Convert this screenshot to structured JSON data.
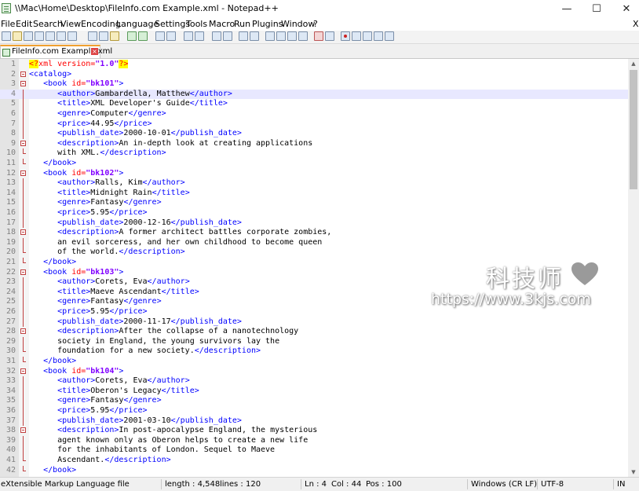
{
  "window": {
    "title": "\\\\Mac\\Home\\Desktop\\FileInfo.com Example.xml - Notepad++",
    "minimize_glyph": "—",
    "maximize_glyph": "☐",
    "close_glyph": "✕"
  },
  "menu": {
    "items": [
      "File",
      "Edit",
      "Search",
      "View",
      "Encoding",
      "Language",
      "Settings",
      "Tools",
      "Macro",
      "Run",
      "Plugins",
      "Window",
      "?"
    ],
    "doc_close": "X"
  },
  "tab": {
    "label": "FileInfo.com Example.xml",
    "close_glyph": "×",
    "icon": "xml-file-icon"
  },
  "editor": {
    "current_line": 4,
    "lines": [
      {
        "n": "1",
        "fold": "none",
        "c": [
          [
            "d",
            "<?"
          ],
          [
            "a",
            "xml version="
          ],
          [
            "v",
            "\"1.0\""
          ],
          [
            "d",
            "?>"
          ]
        ]
      },
      {
        "n": "2",
        "fold": "start",
        "c": [
          [
            "t",
            "<catalog>"
          ]
        ]
      },
      {
        "n": "3",
        "fold": "start",
        "c": [
          [
            "x",
            "   "
          ],
          [
            "t",
            "<book "
          ],
          [
            "a",
            "id="
          ],
          [
            "v",
            "\"bk101\""
          ],
          [
            "t",
            ">"
          ]
        ]
      },
      {
        "n": "4",
        "fold": "line",
        "c": [
          [
            "x",
            "      "
          ],
          [
            "t",
            "<author>"
          ],
          [
            "x",
            "Gambardella, Matthew"
          ],
          [
            "t",
            "</author>"
          ]
        ]
      },
      {
        "n": "5",
        "fold": "line",
        "c": [
          [
            "x",
            "      "
          ],
          [
            "t",
            "<title>"
          ],
          [
            "x",
            "XML Developer's Guide"
          ],
          [
            "t",
            "</title>"
          ]
        ]
      },
      {
        "n": "6",
        "fold": "line",
        "c": [
          [
            "x",
            "      "
          ],
          [
            "t",
            "<genre>"
          ],
          [
            "x",
            "Computer"
          ],
          [
            "t",
            "</genre>"
          ]
        ]
      },
      {
        "n": "7",
        "fold": "line",
        "c": [
          [
            "x",
            "      "
          ],
          [
            "t",
            "<price>"
          ],
          [
            "x",
            "44.95"
          ],
          [
            "t",
            "</price>"
          ]
        ]
      },
      {
        "n": "8",
        "fold": "line",
        "c": [
          [
            "x",
            "      "
          ],
          [
            "t",
            "<publish_date>"
          ],
          [
            "x",
            "2000-10-01"
          ],
          [
            "t",
            "</publish_date>"
          ]
        ]
      },
      {
        "n": "9",
        "fold": "start",
        "c": [
          [
            "x",
            "      "
          ],
          [
            "t",
            "<description>"
          ],
          [
            "x",
            "An in-depth look at creating applications"
          ]
        ]
      },
      {
        "n": "10",
        "fold": "end",
        "c": [
          [
            "x",
            "      with XML."
          ],
          [
            "t",
            "</description>"
          ]
        ]
      },
      {
        "n": "11",
        "fold": "end",
        "c": [
          [
            "x",
            "   "
          ],
          [
            "t",
            "</book>"
          ]
        ]
      },
      {
        "n": "12",
        "fold": "start",
        "c": [
          [
            "x",
            "   "
          ],
          [
            "t",
            "<book "
          ],
          [
            "a",
            "id="
          ],
          [
            "v",
            "\"bk102\""
          ],
          [
            "t",
            ">"
          ]
        ]
      },
      {
        "n": "13",
        "fold": "line",
        "c": [
          [
            "x",
            "      "
          ],
          [
            "t",
            "<author>"
          ],
          [
            "x",
            "Ralls, Kim"
          ],
          [
            "t",
            "</author>"
          ]
        ]
      },
      {
        "n": "14",
        "fold": "line",
        "c": [
          [
            "x",
            "      "
          ],
          [
            "t",
            "<title>"
          ],
          [
            "x",
            "Midnight Rain"
          ],
          [
            "t",
            "</title>"
          ]
        ]
      },
      {
        "n": "15",
        "fold": "line",
        "c": [
          [
            "x",
            "      "
          ],
          [
            "t",
            "<genre>"
          ],
          [
            "x",
            "Fantasy"
          ],
          [
            "t",
            "</genre>"
          ]
        ]
      },
      {
        "n": "16",
        "fold": "line",
        "c": [
          [
            "x",
            "      "
          ],
          [
            "t",
            "<price>"
          ],
          [
            "x",
            "5.95"
          ],
          [
            "t",
            "</price>"
          ]
        ]
      },
      {
        "n": "17",
        "fold": "line",
        "c": [
          [
            "x",
            "      "
          ],
          [
            "t",
            "<publish_date>"
          ],
          [
            "x",
            "2000-12-16"
          ],
          [
            "t",
            "</publish_date>"
          ]
        ]
      },
      {
        "n": "18",
        "fold": "start",
        "c": [
          [
            "x",
            "      "
          ],
          [
            "t",
            "<description>"
          ],
          [
            "x",
            "A former architect battles corporate zombies,"
          ]
        ]
      },
      {
        "n": "19",
        "fold": "line",
        "c": [
          [
            "x",
            "      an evil sorceress, and her own childhood to become queen"
          ]
        ]
      },
      {
        "n": "20",
        "fold": "end",
        "c": [
          [
            "x",
            "      of the world."
          ],
          [
            "t",
            "</description>"
          ]
        ]
      },
      {
        "n": "21",
        "fold": "end",
        "c": [
          [
            "x",
            "   "
          ],
          [
            "t",
            "</book>"
          ]
        ]
      },
      {
        "n": "22",
        "fold": "start",
        "c": [
          [
            "x",
            "   "
          ],
          [
            "t",
            "<book "
          ],
          [
            "a",
            "id="
          ],
          [
            "v",
            "\"bk103\""
          ],
          [
            "t",
            ">"
          ]
        ]
      },
      {
        "n": "23",
        "fold": "line",
        "c": [
          [
            "x",
            "      "
          ],
          [
            "t",
            "<author>"
          ],
          [
            "x",
            "Corets, Eva"
          ],
          [
            "t",
            "</author>"
          ]
        ]
      },
      {
        "n": "24",
        "fold": "line",
        "c": [
          [
            "x",
            "      "
          ],
          [
            "t",
            "<title>"
          ],
          [
            "x",
            "Maeve Ascendant"
          ],
          [
            "t",
            "</title>"
          ]
        ]
      },
      {
        "n": "25",
        "fold": "line",
        "c": [
          [
            "x",
            "      "
          ],
          [
            "t",
            "<genre>"
          ],
          [
            "x",
            "Fantasy"
          ],
          [
            "t",
            "</genre>"
          ]
        ]
      },
      {
        "n": "26",
        "fold": "line",
        "c": [
          [
            "x",
            "      "
          ],
          [
            "t",
            "<price>"
          ],
          [
            "x",
            "5.95"
          ],
          [
            "t",
            "</price>"
          ]
        ]
      },
      {
        "n": "27",
        "fold": "line",
        "c": [
          [
            "x",
            "      "
          ],
          [
            "t",
            "<publish_date>"
          ],
          [
            "x",
            "2000-11-17"
          ],
          [
            "t",
            "</publish_date>"
          ]
        ]
      },
      {
        "n": "28",
        "fold": "start",
        "c": [
          [
            "x",
            "      "
          ],
          [
            "t",
            "<description>"
          ],
          [
            "x",
            "After the collapse of a nanotechnology"
          ]
        ]
      },
      {
        "n": "29",
        "fold": "line",
        "c": [
          [
            "x",
            "      society in England, the young survivors lay the"
          ]
        ]
      },
      {
        "n": "30",
        "fold": "end",
        "c": [
          [
            "x",
            "      foundation for a new society."
          ],
          [
            "t",
            "</description>"
          ]
        ]
      },
      {
        "n": "31",
        "fold": "end",
        "c": [
          [
            "x",
            "   "
          ],
          [
            "t",
            "</book>"
          ]
        ]
      },
      {
        "n": "32",
        "fold": "start",
        "c": [
          [
            "x",
            "   "
          ],
          [
            "t",
            "<book "
          ],
          [
            "a",
            "id="
          ],
          [
            "v",
            "\"bk104\""
          ],
          [
            "t",
            ">"
          ]
        ]
      },
      {
        "n": "33",
        "fold": "line",
        "c": [
          [
            "x",
            "      "
          ],
          [
            "t",
            "<author>"
          ],
          [
            "x",
            "Corets, Eva"
          ],
          [
            "t",
            "</author>"
          ]
        ]
      },
      {
        "n": "34",
        "fold": "line",
        "c": [
          [
            "x",
            "      "
          ],
          [
            "t",
            "<title>"
          ],
          [
            "x",
            "Oberon's Legacy"
          ],
          [
            "t",
            "</title>"
          ]
        ]
      },
      {
        "n": "35",
        "fold": "line",
        "c": [
          [
            "x",
            "      "
          ],
          [
            "t",
            "<genre>"
          ],
          [
            "x",
            "Fantasy"
          ],
          [
            "t",
            "</genre>"
          ]
        ]
      },
      {
        "n": "36",
        "fold": "line",
        "c": [
          [
            "x",
            "      "
          ],
          [
            "t",
            "<price>"
          ],
          [
            "x",
            "5.95"
          ],
          [
            "t",
            "</price>"
          ]
        ]
      },
      {
        "n": "37",
        "fold": "line",
        "c": [
          [
            "x",
            "      "
          ],
          [
            "t",
            "<publish_date>"
          ],
          [
            "x",
            "2001-03-10"
          ],
          [
            "t",
            "</publish_date>"
          ]
        ]
      },
      {
        "n": "38",
        "fold": "start",
        "c": [
          [
            "x",
            "      "
          ],
          [
            "t",
            "<description>"
          ],
          [
            "x",
            "In post-apocalypse England, the mysterious"
          ]
        ]
      },
      {
        "n": "39",
        "fold": "line",
        "c": [
          [
            "x",
            "      agent known only as Oberon helps to create a new life"
          ]
        ]
      },
      {
        "n": "40",
        "fold": "line",
        "c": [
          [
            "x",
            "      for the inhabitants of London. Sequel to Maeve"
          ]
        ]
      },
      {
        "n": "41",
        "fold": "end",
        "c": [
          [
            "x",
            "      Ascendant."
          ],
          [
            "t",
            "</description>"
          ]
        ]
      },
      {
        "n": "42",
        "fold": "end",
        "c": [
          [
            "x",
            "   "
          ],
          [
            "t",
            "</book>"
          ]
        ]
      }
    ]
  },
  "watermark": {
    "text": "科技师",
    "url": "https://www.3kjs.com"
  },
  "status": {
    "file_type": "eXtensible Markup Language file",
    "length": "length : 4,548",
    "lines": "lines : 120",
    "ln": "Ln : 4",
    "col": "Col : 44",
    "pos": "Pos : 100",
    "eol": "Windows (CR LF)",
    "encoding": "UTF-8",
    "mode": "IN"
  },
  "colors": {
    "tag": "#0000ff",
    "attr": "#ff0000",
    "value": "#8000ff",
    "current_line": "#e8e8ff",
    "active_tab_accent": "#f0a030"
  }
}
